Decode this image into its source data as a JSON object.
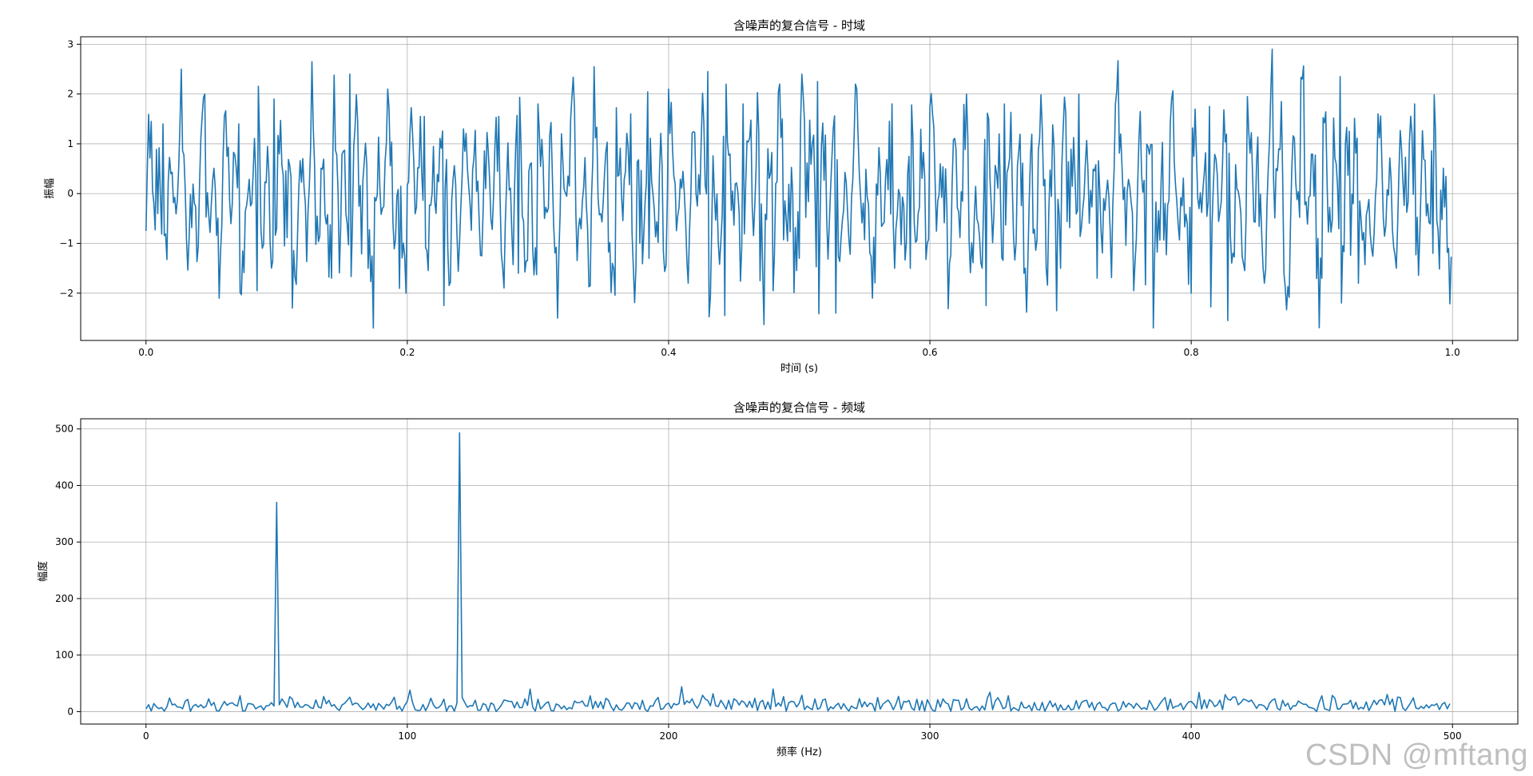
{
  "watermark": "CSDN @mftang",
  "colors": {
    "line": "#1f77b4",
    "grid": "#b0b0b0",
    "axes": "#000000"
  },
  "chart_data": [
    {
      "type": "line",
      "title": "含噪声的复合信号 - 时域",
      "xlabel": "时间 (s)",
      "ylabel": "振幅",
      "xlim": [
        -0.05,
        1.05
      ],
      "ylim": [
        -2.95,
        3.15
      ],
      "xticks": [
        0.0,
        0.2,
        0.4,
        0.6,
        0.8,
        1.0
      ],
      "xtick_labels": [
        "0.0",
        "0.2",
        "0.4",
        "0.6",
        "0.8",
        "1.0"
      ],
      "yticks": [
        -2,
        -1,
        0,
        1,
        2,
        3
      ],
      "ytick_labels": [
        "−2",
        "−1",
        "0",
        "1",
        "2",
        "3"
      ],
      "grid": true,
      "series": [
        {
          "description": "noisy composite signal, 1000 samples over 0–1 s (approximate peaks read from plot)",
          "x": [
            0.0,
            0.004,
            0.009,
            0.013,
            0.027,
            0.033,
            0.045,
            0.056,
            0.071,
            0.085,
            0.098,
            0.112,
            0.127,
            0.142,
            0.156,
            0.17,
            0.185,
            0.199,
            0.213,
            0.228,
            0.243,
            0.257,
            0.27,
            0.285,
            0.3,
            0.315,
            0.328,
            0.343,
            0.357,
            0.371,
            0.385,
            0.4,
            0.415,
            0.43,
            0.443,
            0.457,
            0.47,
            0.485,
            0.5,
            0.514,
            0.528,
            0.543,
            0.556,
            0.571,
            0.585,
            0.6,
            0.615,
            0.628,
            0.643,
            0.657,
            0.672,
            0.686,
            0.7,
            0.714,
            0.728,
            0.742,
            0.756,
            0.771,
            0.785,
            0.8,
            0.814,
            0.828,
            0.843,
            0.856,
            0.862,
            0.871,
            0.885,
            0.9,
            0.914,
            0.928,
            0.943,
            0.957,
            0.971,
            0.985,
            1.0
          ],
          "y": [
            -0.75,
            1.45,
            -0.4,
            1.4,
            2.5,
            -0.9,
            2.0,
            -2.1,
            1.4,
            -1.95,
            1.9,
            -2.3,
            2.65,
            -1.7,
            2.4,
            -1.5,
            2.1,
            -2.0,
            1.55,
            -2.25,
            1.3,
            -1.25,
            1.55,
            -1.6,
            1.8,
            -2.5,
            1.7,
            2.55,
            -1.4,
            1.6,
            -1.3,
            2.1,
            -1.8,
            2.45,
            -2.45,
            1.8,
            -1.75,
            2.2,
            -1.3,
            2.25,
            -2.4,
            2.2,
            -2.1,
            1.8,
            -1.5,
            1.75,
            -1.4,
            2.0,
            -2.25,
            1.8,
            -1.6,
            1.3,
            -1.5,
            2.0,
            -1.7,
            1.8,
            -1.95,
            -2.7,
            1.9,
            -2.0,
            1.75,
            -2.55,
            1.95,
            -1.8,
            2.9,
            -1.6,
            2.3,
            -1.7,
            2.35,
            -1.8,
            1.6,
            -1.5,
            1.8,
            -1.2,
            -0.2
          ]
        }
      ]
    },
    {
      "type": "line",
      "title": "含噪声的复合信号 - 频域",
      "xlabel": "频率 (Hz)",
      "ylabel": "幅度",
      "xlim": [
        -25,
        525
      ],
      "ylim": [
        -22,
        518
      ],
      "xticks": [
        0,
        100,
        200,
        300,
        400,
        500
      ],
      "xtick_labels": [
        "0",
        "100",
        "200",
        "300",
        "400",
        "500"
      ],
      "yticks": [
        0,
        100,
        200,
        300,
        400,
        500
      ],
      "ytick_labels": [
        "0",
        "100",
        "200",
        "300",
        "400",
        "500"
      ],
      "grid": true,
      "series": [
        {
          "description": "FFT magnitude spectrum, 0–499 Hz; noise floor about 0–40, peaks at 50 Hz and 120 Hz",
          "x": [
            0,
            10,
            20,
            30,
            40,
            49,
            50,
            51,
            60,
            70,
            80,
            90,
            100,
            101,
            110,
            119,
            120,
            121,
            130,
            140,
            150,
            160,
            170,
            180,
            190,
            200,
            205,
            210,
            220,
            230,
            240,
            250,
            260,
            270,
            280,
            290,
            300,
            310,
            320,
            330,
            340,
            350,
            360,
            370,
            380,
            390,
            400,
            410,
            420,
            430,
            440,
            450,
            460,
            470,
            480,
            490,
            499
          ],
          "y": [
            5,
            12,
            8,
            18,
            14,
            10,
            370,
            12,
            8,
            20,
            15,
            10,
            18,
            38,
            12,
            15,
            493,
            25,
            12,
            18,
            22,
            10,
            28,
            12,
            20,
            15,
            44,
            12,
            20,
            8,
            40,
            15,
            22,
            10,
            25,
            18,
            12,
            20,
            10,
            28,
            16,
            12,
            20,
            15,
            10,
            25,
            18,
            12,
            22,
            15,
            10,
            28,
            14,
            20,
            25,
            12,
            14
          ]
        }
      ]
    }
  ]
}
